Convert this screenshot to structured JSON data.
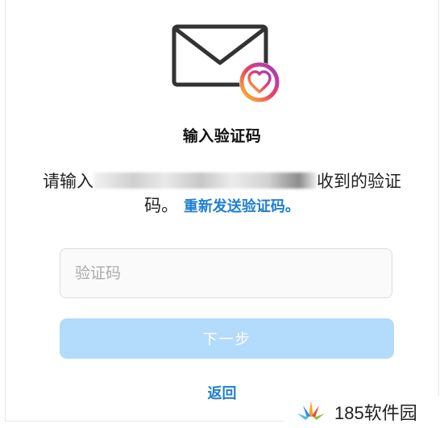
{
  "dialog": {
    "title": "输入验证码",
    "desc_prefix": "请输入",
    "desc_suffix": "收到的验证码。",
    "resend_link": "重新发送验证码。",
    "code_placeholder": "验证码",
    "next_label": "下一步",
    "back_label": "返回"
  },
  "watermark": {
    "text": "185软件园"
  },
  "colors": {
    "accent": "#1f7fd1",
    "button_disabled": "#b3dbfb",
    "icon_gradient": [
      "#f9c42b",
      "#e8406a",
      "#9b3ec0"
    ]
  },
  "icons": [
    "envelope-icon",
    "heart-badge-icon",
    "watermark-logo-icon"
  ]
}
